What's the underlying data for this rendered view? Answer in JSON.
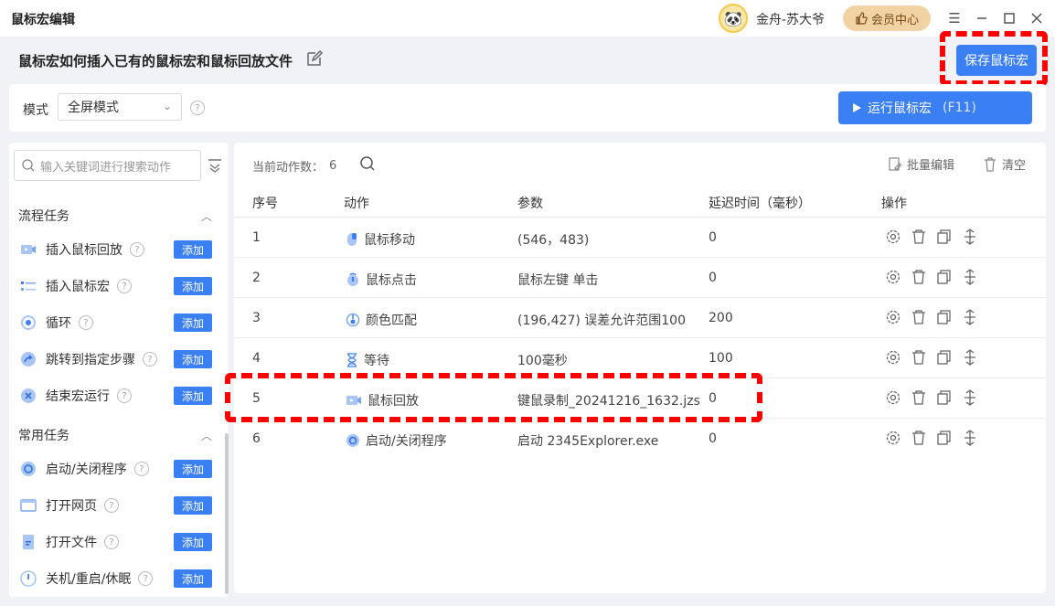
{
  "app": {
    "title": "鼠标宏编辑"
  },
  "user": {
    "name": "金舟-苏大爷",
    "vip_label": "会员中心"
  },
  "header": {
    "doc_title": "鼠标宏如何插入已有的鼠标宏和鼠标回放文件",
    "save_label": "保存鼠标宏"
  },
  "mode": {
    "label": "模式",
    "value": "全屏模式",
    "run_label": "运行鼠标宏",
    "run_hotkey": "(F11)"
  },
  "sidebar": {
    "search_placeholder": "输入关键词进行搜索动作",
    "sections": [
      {
        "title": "流程任务",
        "items": [
          {
            "label": "插入鼠标回放",
            "icon": "playback-icon"
          },
          {
            "label": "插入鼠标宏",
            "icon": "macro-icon"
          },
          {
            "label": "循环",
            "icon": "loop-icon"
          },
          {
            "label": "跳转到指定步骤",
            "icon": "jump-icon"
          },
          {
            "label": "结束宏运行",
            "icon": "stop-icon"
          }
        ]
      },
      {
        "title": "常用任务",
        "items": [
          {
            "label": "启动/关闭程序",
            "icon": "program-icon"
          },
          {
            "label": "打开网页",
            "icon": "webpage-icon"
          },
          {
            "label": "打开文件",
            "icon": "file-icon"
          },
          {
            "label": "关机/重启/休眠",
            "icon": "power-icon"
          }
        ]
      }
    ],
    "add_label": "添加"
  },
  "main": {
    "count_label": "当前动作数：",
    "count_value": "6",
    "batch_edit_label": "批量编辑",
    "clear_label": "清空",
    "columns": [
      "序号",
      "动作",
      "参数",
      "延迟时间（毫秒）",
      "操作"
    ],
    "rows": [
      {
        "index": "1",
        "action": "鼠标移动",
        "param": "(546，483)",
        "delay": "0",
        "icon": "mouse-move-icon"
      },
      {
        "index": "2",
        "action": "鼠标点击",
        "param": "鼠标左键 单击",
        "delay": "0",
        "icon": "mouse-click-icon"
      },
      {
        "index": "3",
        "action": "颜色匹配",
        "param": "(196,427) 误差允许范围100",
        "delay": "200",
        "icon": "color-match-icon"
      },
      {
        "index": "4",
        "action": "等待",
        "param": "100毫秒",
        "delay": "100",
        "icon": "hourglass-icon"
      },
      {
        "index": "5",
        "action": "鼠标回放",
        "param": "键鼠录制_20241216_1632.jzs",
        "delay": "0",
        "icon": "playback-icon"
      },
      {
        "index": "6",
        "action": "启动/关闭程序",
        "param": "启动 2345Explorer.exe",
        "delay": "0",
        "icon": "program-icon"
      }
    ]
  },
  "colors": {
    "accent": "#3b7ff5",
    "highlight": "#ff0000",
    "vip_bg": "#f1d2a3"
  }
}
